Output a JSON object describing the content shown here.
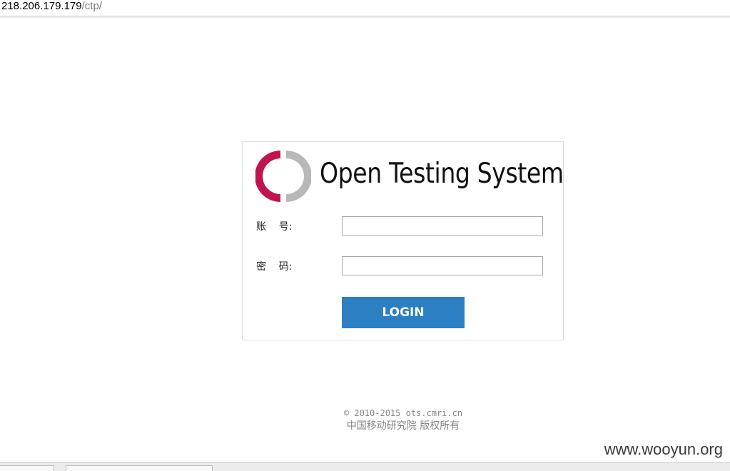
{
  "address_bar": {
    "host": "218.206.179.179",
    "path": "/ctp/"
  },
  "login": {
    "system_title": "Open Testing System",
    "account_label": "账    号:",
    "password_label": "密    码:",
    "account_value": "",
    "password_value": "",
    "login_button": "LOGIN"
  },
  "logo": {
    "icon": "ots-ring-logo",
    "left_color": "#c0134f",
    "right_color": "#b8b8b8"
  },
  "footer": {
    "copyright": "© 2010-2015 ots.cmri.cn",
    "organization": "中国移动研究院 版权所有"
  },
  "watermark": "www.wooyun.org",
  "colors": {
    "login_button": "#2b7fc2",
    "footer_text": "#858585"
  }
}
